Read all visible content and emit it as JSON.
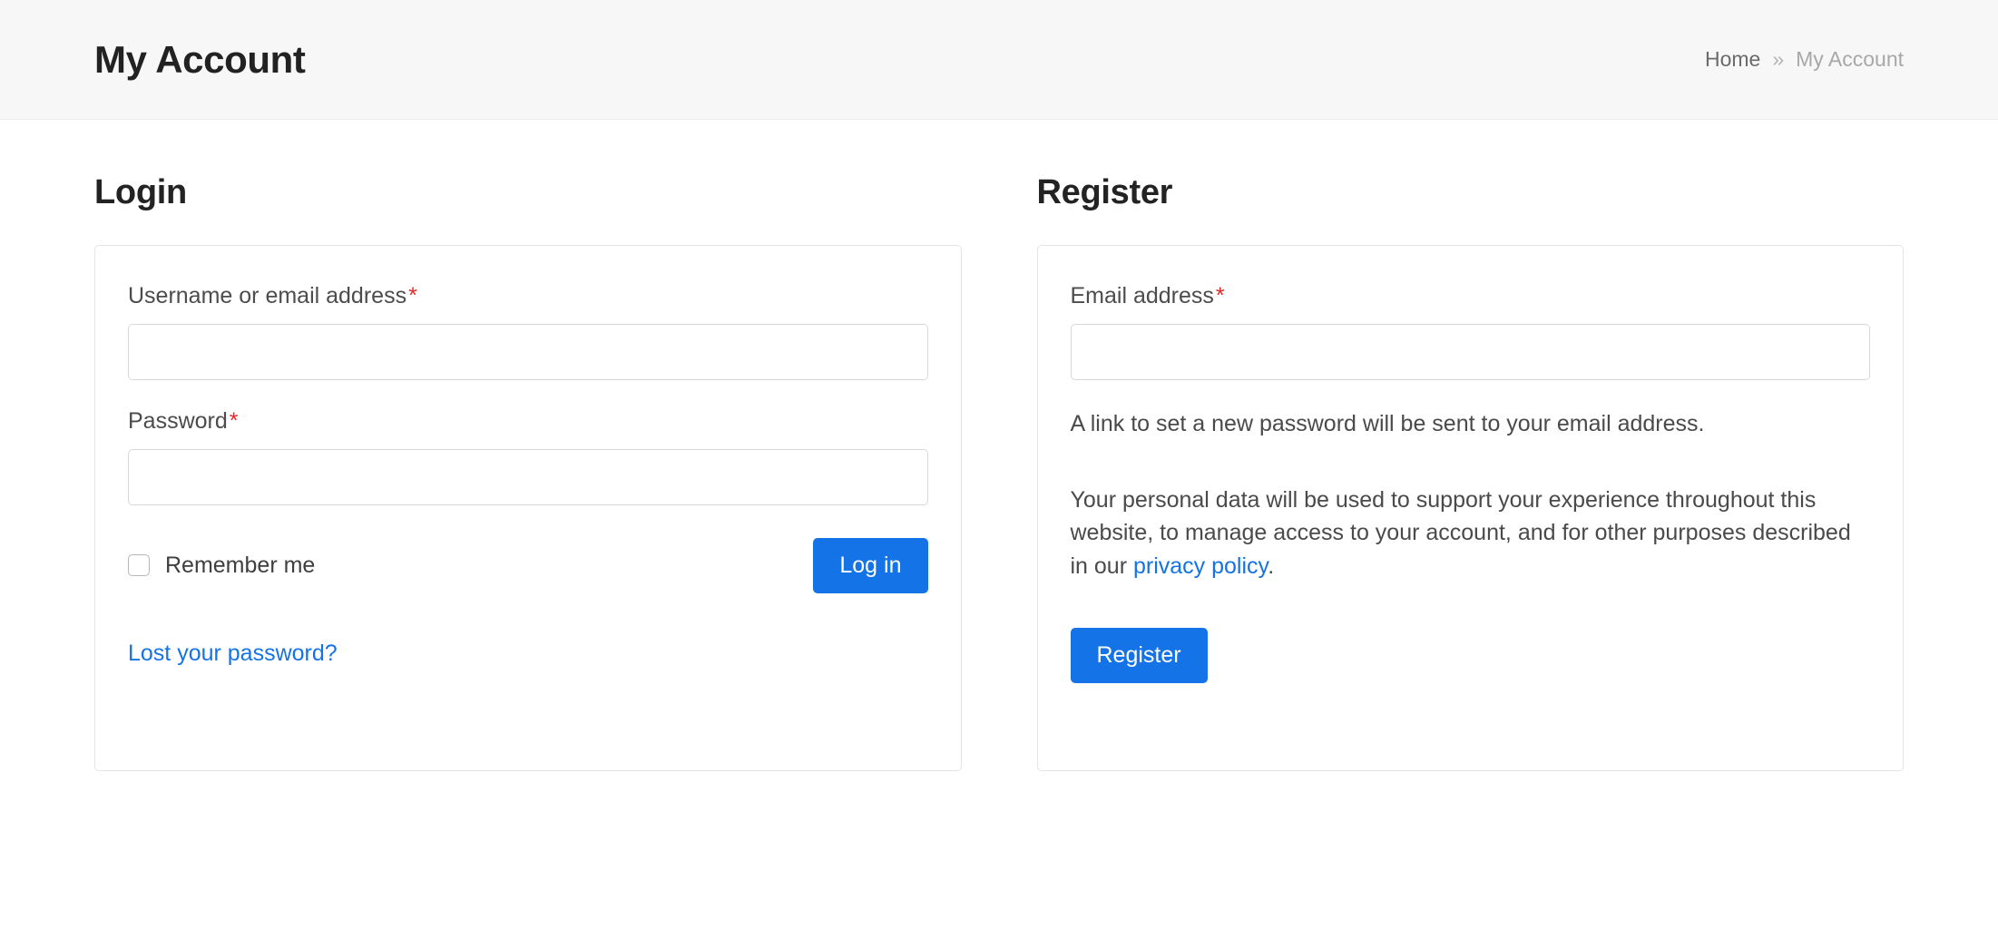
{
  "header": {
    "title": "My Account",
    "breadcrumb": {
      "home": "Home",
      "separator": "»",
      "current": "My Account"
    }
  },
  "login": {
    "heading": "Login",
    "username_field": {
      "label": "Username or email address",
      "required_mark": "*",
      "value": "",
      "placeholder": ""
    },
    "password_field": {
      "label": "Password",
      "required_mark": "*",
      "value": "",
      "placeholder": ""
    },
    "remember_label": "Remember me",
    "remember_checked": false,
    "submit_label": "Log in",
    "lost_password_label": "Lost your password?"
  },
  "register": {
    "heading": "Register",
    "email_field": {
      "label": "Email address",
      "required_mark": "*",
      "value": "",
      "placeholder": ""
    },
    "note_password": "A link to set a new password will be sent to your email address.",
    "privacy_note_before": "Your personal data will be used to support your experience throughout this website, to manage access to your account, and for other purposes described in our ",
    "privacy_link_label": "privacy policy",
    "privacy_note_after": ".",
    "submit_label": "Register"
  },
  "colors": {
    "accent": "#1473e6",
    "required": "#e02b27",
    "header_bg": "#f7f7f7",
    "border": "#e4e4e4",
    "input_border": "#d8d8d8",
    "text": "#333333",
    "muted_text": "#9a9a9a"
  }
}
